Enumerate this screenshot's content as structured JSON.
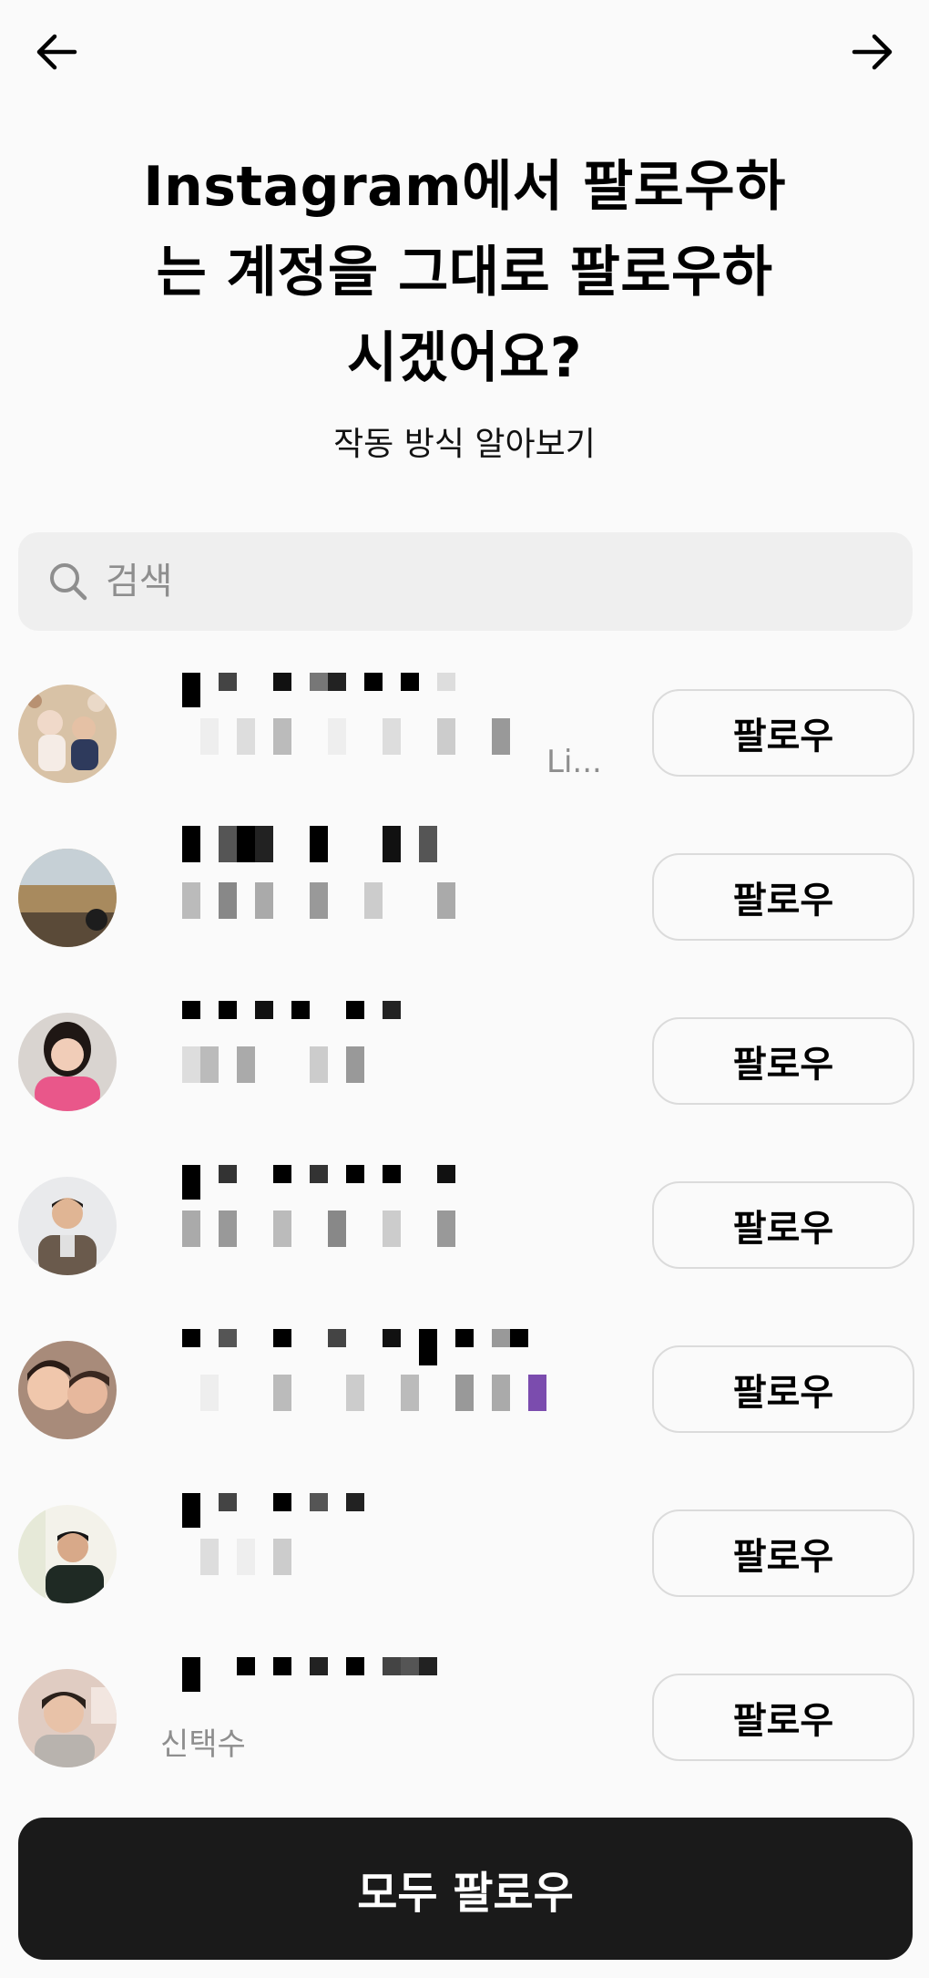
{
  "nav": {
    "back_icon": "arrow-left-icon",
    "forward_icon": "arrow-right-icon"
  },
  "header": {
    "title_line1": "Instagram에서 팔로우하",
    "title_line2": "는 계정을 그대로 팔로우하",
    "title_line3": "시겠어요?",
    "learn_more": "작동 방식 알아보기"
  },
  "search": {
    "placeholder": "검색",
    "icon": "search-icon"
  },
  "accounts": [
    {
      "follow_label": "팔로우",
      "visible_subtext": "Li..."
    },
    {
      "follow_label": "팔로우",
      "visible_subtext": ""
    },
    {
      "follow_label": "팔로우",
      "visible_subtext": ""
    },
    {
      "follow_label": "팔로우",
      "visible_subtext": ""
    },
    {
      "follow_label": "팔로우",
      "visible_subtext": ""
    },
    {
      "follow_label": "팔로우",
      "visible_subtext": ""
    },
    {
      "follow_label": "팔로우",
      "visible_subtext": "신택수"
    }
  ],
  "footer": {
    "follow_all_label": "모두 팔로우"
  },
  "colors": {
    "background": "#fafafa",
    "primary_button": "#1a1a1a",
    "muted_text": "#8e8e8e",
    "border": "#dbdbdb"
  }
}
